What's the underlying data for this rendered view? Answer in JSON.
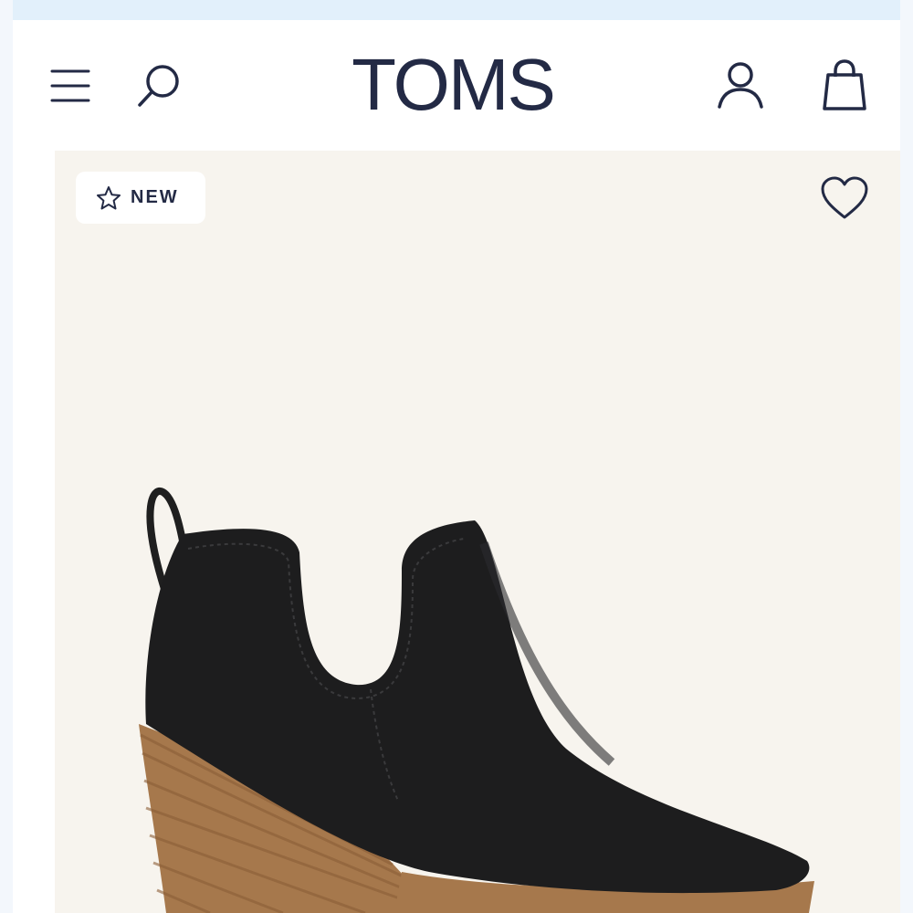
{
  "header": {
    "logo_text": "TOMS",
    "icons": {
      "menu": "hamburger-menu-icon",
      "search": "search-icon",
      "account": "user-account-icon",
      "bag": "shopping-bag-icon"
    }
  },
  "product": {
    "badge_label": "NEW",
    "badge_icon": "star-outline-icon",
    "wishlist_icon": "heart-outline-icon",
    "image_description": "black-leather-wedge-bootie"
  },
  "colors": {
    "brand_navy": "#232a45",
    "card_background": "#f7f4ee",
    "banner": "#e2f0fb"
  }
}
